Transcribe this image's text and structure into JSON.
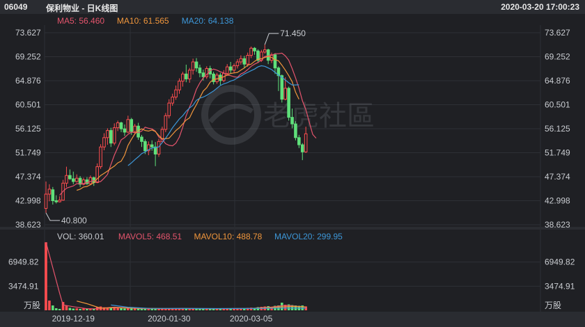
{
  "header": {
    "code": "06049",
    "name": "保利物业 - 日K线图",
    "timestamp": "2020-03-20 17:00:23"
  },
  "watermark": "老虎社區",
  "price_legend": [
    {
      "key": "MA5",
      "value": "56.460",
      "color": "#e4546c"
    },
    {
      "key": "MA10",
      "value": "61.565",
      "color": "#f0963c"
    },
    {
      "key": "MA20",
      "value": "64.138",
      "color": "#3d97d8"
    }
  ],
  "volume_legend": [
    {
      "key": "VOL",
      "value": "360.01",
      "color": "#c9ccd1"
    },
    {
      "key": "MAVOL5",
      "value": "468.51",
      "color": "#e4546c"
    },
    {
      "key": "MAVOL10",
      "value": "488.78",
      "color": "#f0963c"
    },
    {
      "key": "MAVOL20",
      "value": "299.95",
      "color": "#3d97d8"
    }
  ],
  "colors": {
    "up": "#ff4d4f",
    "down": "#5fe07a"
  },
  "chart_data": {
    "type": "candlestick",
    "price_axis": {
      "range": [
        38.623,
        73.627
      ],
      "ticks": [
        "73.627",
        "69.252",
        "64.876",
        "60.501",
        "56.125",
        "51.749",
        "47.374",
        "42.998",
        "38.623"
      ]
    },
    "volume_axis": {
      "range": [
        0,
        10424.73
      ],
      "ticks": [
        "6949.82",
        "3474.91"
      ],
      "unit": "万股"
    },
    "x_labels": [
      {
        "label": "2019-12-19",
        "index": 8
      },
      {
        "label": "2020-01-30",
        "index": 36
      },
      {
        "label": "2020-03-05",
        "index": 60
      }
    ],
    "annotations": [
      {
        "text": "71.450",
        "index": 64,
        "value": 71.45
      },
      {
        "text": "40.800",
        "index": 0,
        "value": 40.8
      }
    ],
    "candles": [
      [
        41.6,
        44.2,
        46.5,
        40.8
      ],
      [
        44.2,
        45.1,
        46.0,
        42.9
      ],
      [
        45.0,
        43.0,
        45.5,
        42.3
      ],
      [
        43.0,
        42.8,
        44.0,
        42.5
      ],
      [
        42.8,
        43.1,
        43.8,
        42.7
      ],
      [
        43.1,
        46.2,
        46.8,
        43.0
      ],
      [
        46.2,
        47.6,
        49.2,
        45.5
      ],
      [
        47.6,
        47.0,
        48.7,
        46.8
      ],
      [
        47.0,
        46.5,
        48.3,
        46.0
      ],
      [
        46.5,
        47.1,
        47.8,
        46.3
      ],
      [
        47.1,
        46.0,
        47.5,
        45.5
      ],
      [
        46.0,
        46.8,
        47.2,
        45.8
      ],
      [
        46.8,
        46.1,
        47.3,
        45.9
      ],
      [
        46.1,
        47.2,
        47.6,
        45.9
      ],
      [
        47.2,
        46.3,
        47.4,
        45.7
      ],
      [
        46.3,
        49.2,
        49.8,
        46.2
      ],
      [
        49.2,
        52.8,
        53.3,
        48.8
      ],
      [
        52.8,
        54.5,
        55.3,
        52.2
      ],
      [
        54.5,
        55.8,
        56.2,
        53.2
      ],
      [
        55.8,
        53.5,
        56.3,
        52.8
      ],
      [
        53.5,
        56.3,
        57.1,
        53.1
      ],
      [
        56.3,
        57.2,
        57.6,
        55.7
      ],
      [
        57.2,
        56.1,
        57.4,
        55.5
      ],
      [
        56.1,
        55.5,
        56.9,
        54.8
      ],
      [
        55.5,
        57.8,
        58.5,
        55.3
      ],
      [
        57.8,
        55.6,
        58.1,
        55.0
      ],
      [
        55.6,
        56.6,
        57.0,
        55.2
      ],
      [
        56.6,
        54.6,
        57.2,
        54.1
      ],
      [
        54.6,
        53.8,
        55.0,
        52.8
      ],
      [
        53.8,
        52.1,
        54.2,
        51.5
      ],
      [
        52.1,
        53.2,
        53.8,
        51.3
      ],
      [
        53.2,
        52.8,
        54.0,
        52.1
      ],
      [
        52.8,
        51.5,
        53.7,
        49.3
      ],
      [
        51.5,
        53.8,
        54.3,
        51.0
      ],
      [
        53.8,
        56.0,
        56.5,
        53.5
      ],
      [
        56.0,
        58.5,
        59.0,
        55.5
      ],
      [
        58.5,
        60.8,
        61.5,
        58.0
      ],
      [
        60.8,
        61.9,
        62.5,
        60.3
      ],
      [
        61.9,
        63.2,
        64.0,
        61.4
      ],
      [
        63.2,
        64.8,
        65.3,
        62.5
      ],
      [
        64.8,
        66.1,
        66.5,
        63.8
      ],
      [
        66.1,
        65.2,
        67.8,
        64.6
      ],
      [
        65.2,
        66.8,
        67.2,
        64.5
      ],
      [
        66.8,
        68.3,
        68.9,
        66.0
      ],
      [
        68.3,
        67.2,
        69.0,
        66.5
      ],
      [
        67.2,
        66.3,
        67.8,
        65.5
      ],
      [
        66.3,
        65.6,
        66.9,
        64.9
      ],
      [
        65.6,
        67.1,
        67.5,
        65.2
      ],
      [
        67.1,
        66.1,
        67.6,
        65.3
      ],
      [
        66.1,
        64.7,
        66.5,
        64.2
      ],
      [
        64.7,
        65.9,
        66.3,
        64.3
      ],
      [
        65.9,
        64.9,
        66.3,
        64.1
      ],
      [
        64.9,
        66.2,
        66.8,
        64.6
      ],
      [
        66.2,
        67.4,
        67.9,
        65.8
      ],
      [
        67.4,
        66.8,
        68.3,
        66.2
      ],
      [
        66.8,
        67.6,
        68.0,
        66.3
      ],
      [
        67.6,
        68.3,
        68.8,
        67.1
      ],
      [
        68.3,
        68.9,
        69.5,
        67.8
      ],
      [
        68.9,
        67.9,
        69.4,
        67.2
      ],
      [
        67.9,
        69.5,
        70.0,
        67.4
      ],
      [
        69.5,
        70.8,
        71.1,
        69.0
      ],
      [
        70.8,
        70.3,
        71.0,
        69.6
      ],
      [
        70.3,
        68.6,
        70.6,
        68.1
      ],
      [
        68.6,
        70.1,
        70.5,
        68.3
      ],
      [
        70.1,
        70.5,
        71.45,
        69.8
      ],
      [
        70.5,
        68.6,
        70.7,
        67.9
      ],
      [
        68.6,
        69.6,
        70.0,
        68.1
      ],
      [
        69.6,
        67.2,
        69.9,
        66.1
      ],
      [
        67.2,
        65.8,
        67.5,
        63.0
      ],
      [
        65.8,
        61.5,
        66.0,
        60.9
      ],
      [
        61.5,
        63.5,
        65.5,
        61.3
      ],
      [
        63.5,
        58.2,
        63.8,
        57.6
      ],
      [
        58.2,
        57.0,
        59.8,
        56.2
      ],
      [
        57.0,
        54.5,
        57.5,
        54.0
      ],
      [
        54.5,
        53.2,
        55.0,
        52.6
      ],
      [
        53.2,
        51.9,
        53.5,
        50.4
      ],
      [
        51.9,
        55.2,
        56.5,
        51.7
      ]
    ],
    "volumes": [
      [
        9800,
        1
      ],
      [
        1400,
        1
      ],
      [
        700,
        0
      ],
      [
        300,
        0
      ],
      [
        200,
        0
      ],
      [
        1200,
        1
      ],
      [
        700,
        1
      ],
      [
        350,
        0
      ],
      [
        250,
        0
      ],
      [
        280,
        1
      ],
      [
        200,
        0
      ],
      [
        250,
        1
      ],
      [
        200,
        0
      ],
      [
        240,
        1
      ],
      [
        200,
        0
      ],
      [
        500,
        1
      ],
      [
        550,
        1
      ],
      [
        430,
        1
      ],
      [
        400,
        1
      ],
      [
        380,
        0
      ],
      [
        400,
        1
      ],
      [
        350,
        1
      ],
      [
        320,
        0
      ],
      [
        260,
        0
      ],
      [
        280,
        1
      ],
      [
        250,
        0
      ],
      [
        260,
        1
      ],
      [
        230,
        0
      ],
      [
        220,
        0
      ],
      [
        200,
        0
      ],
      [
        260,
        1
      ],
      [
        220,
        0
      ],
      [
        300,
        0
      ],
      [
        260,
        1
      ],
      [
        280,
        1
      ],
      [
        300,
        1
      ],
      [
        300,
        1
      ],
      [
        260,
        1
      ],
      [
        240,
        1
      ],
      [
        230,
        1
      ],
      [
        260,
        1
      ],
      [
        240,
        0
      ],
      [
        230,
        1
      ],
      [
        250,
        1
      ],
      [
        220,
        0
      ],
      [
        210,
        0
      ],
      [
        200,
        0
      ],
      [
        230,
        1
      ],
      [
        210,
        0
      ],
      [
        200,
        0
      ],
      [
        220,
        1
      ],
      [
        200,
        0
      ],
      [
        230,
        1
      ],
      [
        260,
        1
      ],
      [
        220,
        0
      ],
      [
        240,
        1
      ],
      [
        260,
        1
      ],
      [
        300,
        1
      ],
      [
        220,
        0
      ],
      [
        350,
        1
      ],
      [
        380,
        1
      ],
      [
        300,
        0
      ],
      [
        450,
        0
      ],
      [
        500,
        1
      ],
      [
        550,
        1
      ],
      [
        600,
        0
      ],
      [
        500,
        1
      ],
      [
        650,
        0
      ],
      [
        700,
        0
      ],
      [
        1100,
        0
      ],
      [
        800,
        1
      ],
      [
        850,
        0
      ],
      [
        750,
        0
      ],
      [
        700,
        0
      ],
      [
        650,
        0
      ],
      [
        700,
        0
      ],
      [
        560,
        1
      ]
    ],
    "series": [
      {
        "name": "MA5",
        "start": 4,
        "values": [
          44.0,
          44.7,
          45.3,
          45.5,
          45.7,
          46.1,
          46.1,
          46.1,
          46.3,
          46.5,
          46.7,
          46.4,
          46.5,
          47.1,
          47.8,
          49.6,
          51.3,
          52.7,
          54.1,
          54.5,
          55.1,
          55.5,
          55.4,
          55.4,
          55.7,
          56.4,
          56.2,
          56.1,
          55.7,
          54.6,
          54.2,
          53.4,
          53.1,
          53.0,
          53.5,
          54.6,
          56.4,
          58.5,
          60.1,
          61.5,
          63.3,
          64.5,
          65.4,
          66.0,
          66.7,
          67.0,
          66.8,
          66.5,
          66.3,
          65.9,
          65.8,
          65.6,
          65.5,
          66.1,
          66.4,
          66.9,
          67.5,
          67.9,
          68.2,
          68.6,
          69.3,
          69.4,
          69.5,
          69.8,
          69.8,
          69.9,
          69.4,
          68.6,
          67.1,
          65.4,
          63.5,
          61.2,
          59.6,
          57.3,
          55.1,
          54.4
        ]
      },
      {
        "name": "MA10",
        "start": 9,
        "values": [
          44.9,
          45.1,
          45.5,
          45.6,
          45.9,
          46.3,
          47.0,
          47.6,
          48.0,
          48.4,
          48.9,
          49.3,
          49.9,
          50.2,
          51.3,
          53.1,
          54.2,
          55.2,
          55.8,
          56.1,
          55.8,
          55.7,
          55.9,
          55.6,
          54.9,
          54.3,
          54.3,
          54.4,
          55.1,
          55.8,
          56.3,
          57.0,
          57.7,
          58.1,
          59.4,
          60.5,
          61.8,
          63.0,
          63.6,
          64.6,
          65.1,
          65.2,
          65.4,
          65.6,
          65.9,
          66.2,
          66.3,
          66.4,
          66.8,
          67.2,
          67.7,
          67.9,
          68.4,
          68.8,
          68.9,
          69.1,
          69.3,
          69.1,
          68.7,
          68.5,
          67.7,
          66.8,
          65.8,
          64.7,
          62.8,
          61.5
        ]
      },
      {
        "name": "MA20",
        "start": 24,
        "values": [
          49.4,
          49.9,
          50.5,
          51.0,
          51.6,
          51.9,
          52.3,
          52.6,
          52.7,
          52.8,
          53.6,
          54.4,
          55.3,
          56.3,
          57.1,
          57.9,
          58.5,
          59.3,
          59.9,
          60.4,
          61.3,
          61.7,
          61.9,
          62.2,
          62.6,
          63.0,
          63.5,
          64.0,
          64.3,
          64.5,
          64.8,
          65.0,
          65.4,
          65.7,
          66.1,
          66.4,
          66.7,
          67.0,
          67.4,
          67.6,
          67.5,
          67.2,
          66.9,
          66.4,
          65.9,
          65.5,
          65.0,
          64.5,
          64.1,
          64.1,
          64.138
        ]
      },
      {
        "name": "MAVOL5",
        "volume": true,
        "values": [
          [
            0,
            9800
          ],
          [
            4,
            2480
          ],
          [
            5,
            760
          ],
          [
            8,
            520
          ],
          [
            12,
            230
          ],
          [
            14,
            220
          ],
          [
            16,
            300
          ],
          [
            20,
            450
          ],
          [
            24,
            340
          ],
          [
            28,
            250
          ],
          [
            34,
            230
          ],
          [
            40,
            260
          ],
          [
            50,
            240
          ],
          [
            60,
            270
          ],
          [
            66,
            470
          ],
          [
            70,
            710
          ],
          [
            76,
            470
          ]
        ]
      },
      {
        "name": "MAVOL10",
        "volume": true,
        "values": [
          [
            9,
            1330
          ],
          [
            12,
            950
          ],
          [
            16,
            300
          ],
          [
            20,
            380
          ],
          [
            24,
            320
          ],
          [
            28,
            290
          ],
          [
            34,
            250
          ],
          [
            40,
            250
          ],
          [
            50,
            235
          ],
          [
            60,
            260
          ],
          [
            66,
            420
          ],
          [
            72,
            560
          ],
          [
            76,
            490
          ]
        ]
      },
      {
        "name": "MAVOL20",
        "volume": true,
        "values": [
          [
            19,
            760
          ],
          [
            24,
            440
          ],
          [
            30,
            280
          ],
          [
            40,
            260
          ],
          [
            50,
            250
          ],
          [
            60,
            260
          ],
          [
            70,
            330
          ],
          [
            76,
            300
          ]
        ]
      }
    ]
  }
}
